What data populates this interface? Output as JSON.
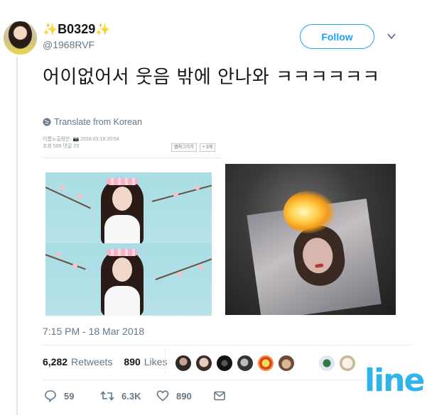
{
  "author": {
    "display_name": "B0329",
    "sparkle_left": "✨",
    "sparkle_right": "✨",
    "handle": "@1968RVF"
  },
  "follow_label": "Follow",
  "tweet": {
    "text": "어이없어서 웃음 밖에 안나와 ㅋㅋㅋㅋㅋㅋ",
    "translate_label": "Translate from Korean"
  },
  "snippet": {
    "meta_line1": "이름노출됐은. 📷 2018.03.18 20:54",
    "meta_line2": "조회 595  댓글 23",
    "btn1": "캡쳐그기기",
    "btn2": "+ 3개"
  },
  "timestamp": "7:15 PM - 18 Mar 2018",
  "stats": {
    "retweets_count": "6,282",
    "retweets_label": "Retweets",
    "likes_count": "890",
    "likes_label": "Likes"
  },
  "actions": {
    "reply_count": "59",
    "retweet_count": "6.3K",
    "like_count": "890"
  },
  "watermark": "line",
  "colors": {
    "accent": "#1da1f2",
    "muted": "#657786",
    "watermark": "#2fb4e9"
  }
}
